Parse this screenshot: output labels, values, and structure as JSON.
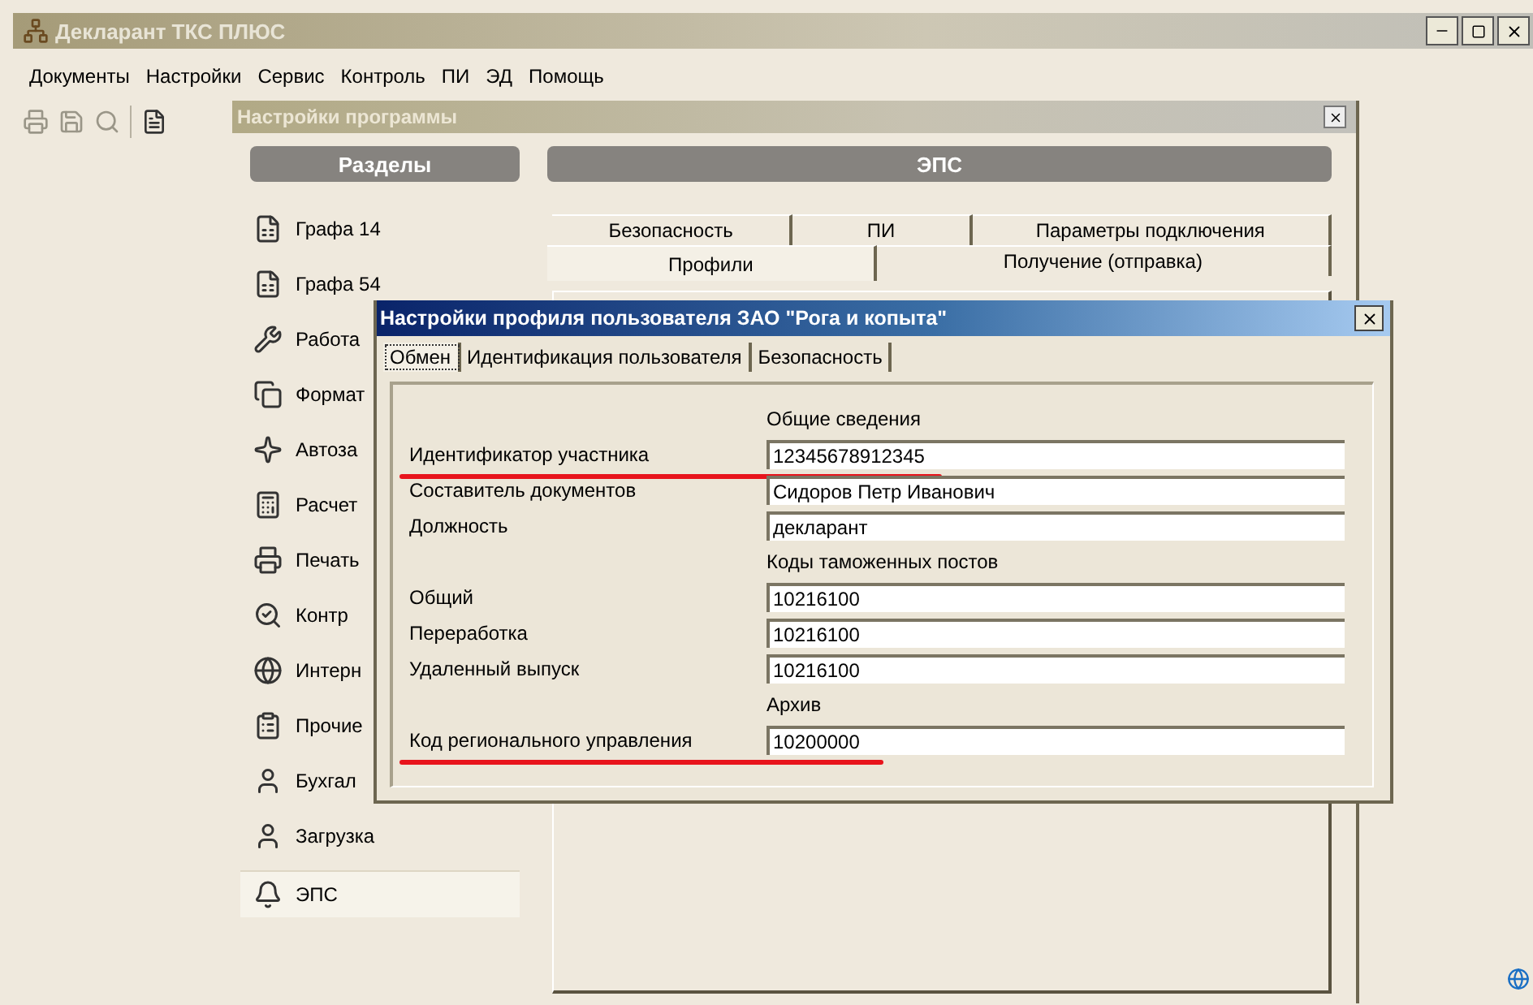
{
  "window": {
    "title": "Декларант ТКС ПЛЮС"
  },
  "menu": [
    "Документы",
    "Настройки",
    "Сервис",
    "Контроль",
    "ПИ",
    "ЭД",
    "Помощь"
  ],
  "settings_dialog": {
    "title": "Настройки программы",
    "sections_header": "Разделы",
    "content_header": "ЭПС",
    "sections": [
      {
        "label": "Графа 14",
        "selected": false
      },
      {
        "label": "Графа 54",
        "selected": false
      },
      {
        "label": "Работа",
        "selected": false
      },
      {
        "label": "Формат",
        "selected": false
      },
      {
        "label": "Автоза",
        "selected": false
      },
      {
        "label": "Расчет",
        "selected": false
      },
      {
        "label": "Печать",
        "selected": false
      },
      {
        "label": "Контр",
        "selected": false
      },
      {
        "label": "Интерн",
        "selected": false
      },
      {
        "label": "Прочие",
        "selected": false
      },
      {
        "label": "Бухгал",
        "selected": false
      },
      {
        "label": "Загрузка",
        "selected": false
      },
      {
        "label": "ЭПС",
        "selected": true
      }
    ],
    "tab_rows": [
      [
        {
          "label": "Безопасность",
          "selected": false
        },
        {
          "label": "ПИ",
          "selected": false
        },
        {
          "label": "Параметры подключения",
          "selected": false
        }
      ],
      [
        {
          "label": "Профили",
          "selected": true
        },
        {
          "label": "Получение (отправка)",
          "selected": false
        }
      ]
    ]
  },
  "profile_dialog": {
    "title": "Настройки профиля пользователя ЗАО \"Рога и копыта\"",
    "tabs": [
      {
        "label": "Обмен",
        "selected": true
      },
      {
        "label": "Идентификация пользователя",
        "selected": false
      },
      {
        "label": "Безопасность",
        "selected": false
      }
    ],
    "rows": [
      {
        "kind": "heading",
        "text": "Общие сведения"
      },
      {
        "kind": "field",
        "label": "Идентификатор участника",
        "value": "12345678912345",
        "underlined": true
      },
      {
        "kind": "field",
        "label": "Составитель документов",
        "value": "Сидоров Петр Иванович",
        "underlined": false
      },
      {
        "kind": "field",
        "label": "Должность",
        "value": "декларант",
        "underlined": false
      },
      {
        "kind": "heading",
        "text": "Коды таможенных постов"
      },
      {
        "kind": "field",
        "label": "Общий",
        "value": "10216100",
        "underlined": false
      },
      {
        "kind": "field",
        "label": "Переработка",
        "value": "10216100",
        "underlined": false
      },
      {
        "kind": "field",
        "label": "Удаленный выпуск",
        "value": "10216100",
        "underlined": false
      },
      {
        "kind": "heading",
        "text": "Архив"
      },
      {
        "kind": "field",
        "label": "Код регионального управления",
        "value": "10200000",
        "underlined": true
      }
    ]
  }
}
